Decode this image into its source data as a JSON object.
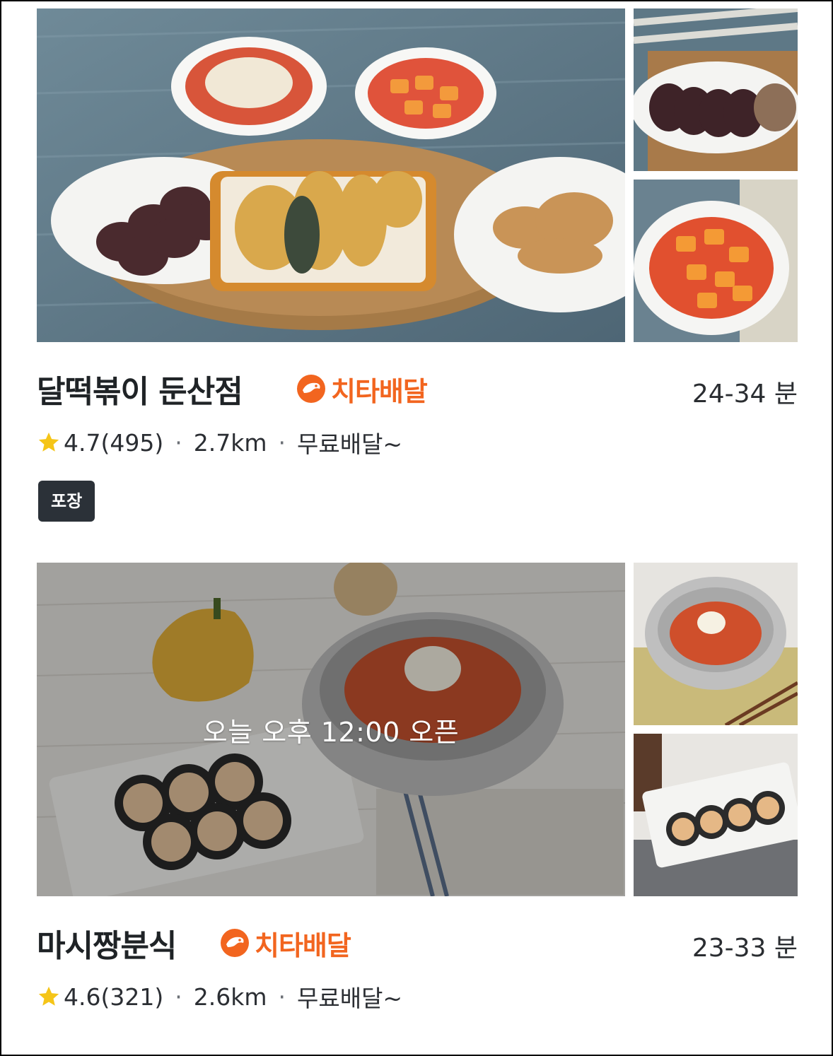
{
  "stores": [
    {
      "name": "달떡볶이 둔산점",
      "delivery_badge": "치타배달",
      "eta": "24-34 분",
      "rating": "4.7",
      "reviews": "(495)",
      "distance": "2.7km",
      "delivery_fee": "무료배달~",
      "tag": "포장",
      "photos": [
        "tteokbokki-platter-photo",
        "sundae-plate-photo",
        "tteokbokki-bowl-photo"
      ]
    },
    {
      "name": "마시짱분식",
      "delivery_badge": "치타배달",
      "eta": "23-33 분",
      "rating": "4.6",
      "reviews": "(321)",
      "distance": "2.6km",
      "delivery_fee": "무료배달~",
      "closed_notice": "오늘 오후 12:00 오픈",
      "photos": [
        "bibim-noodle-kimbap-photo",
        "bibim-noodle-bowl-photo",
        "kimbap-plate-photo"
      ]
    }
  ],
  "colors": {
    "accent": "#f2651f",
    "star": "#f5c518",
    "tag_bg": "#2b3138",
    "text": "#1f2326"
  }
}
